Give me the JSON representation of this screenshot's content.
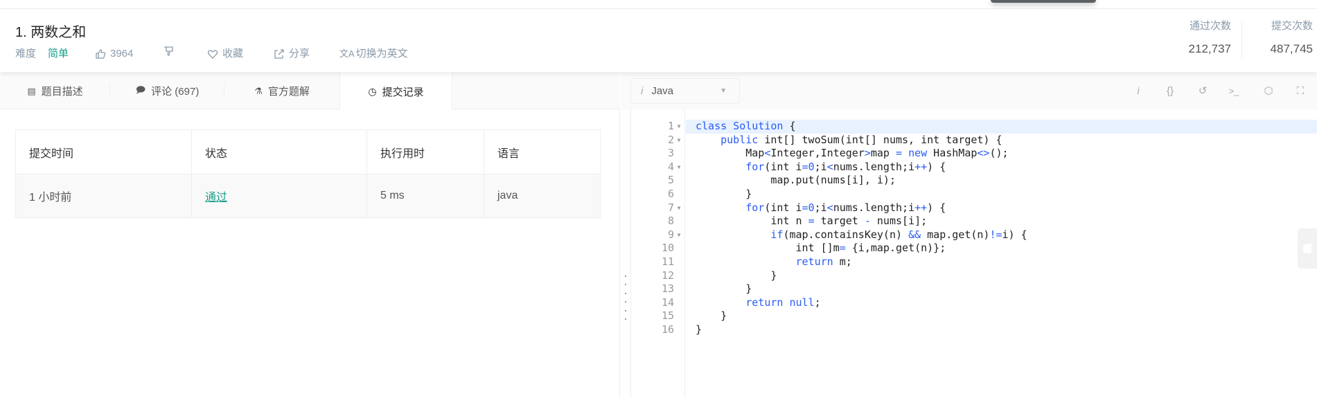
{
  "header": {
    "title": "1. 两数之和",
    "difficulty_label": "难度",
    "difficulty": "简单",
    "likes": "3964",
    "favorite": "收藏",
    "share": "分享",
    "translate": "切换为英文",
    "stats": [
      {
        "label": "通过次数",
        "value": "212,737"
      },
      {
        "label": "提交次数",
        "value": "487,745"
      }
    ]
  },
  "tabs": [
    {
      "label": "题目描述",
      "icon": "document-icon"
    },
    {
      "label": "评论 (697)",
      "icon": "comment-icon"
    },
    {
      "label": "官方题解",
      "icon": "flask-icon"
    },
    {
      "label": "提交记录",
      "icon": "clock-icon",
      "active": true
    }
  ],
  "submissions": {
    "headers": [
      "提交时间",
      "状态",
      "执行用时",
      "语言"
    ],
    "rows": [
      {
        "time": "1 小时前",
        "status": "通过",
        "runtime": "5 ms",
        "language": "java"
      }
    ]
  },
  "editor": {
    "language": "Java",
    "toolbar": [
      "info-icon",
      "format-braces-icon",
      "reset-icon",
      "console-icon",
      "settings-icon",
      "fullscreen-icon"
    ],
    "lines": [
      [
        [
          "class Solution",
          "k"
        ],
        [
          " {",
          ""
        ]
      ],
      [
        [
          "    ",
          ""
        ],
        [
          "public",
          "k"
        ],
        [
          " int[] twoSum(int[] nums, int target) {",
          ""
        ]
      ],
      [
        [
          "        Map",
          ""
        ],
        [
          "<",
          "k"
        ],
        [
          "Integer,Integer",
          ""
        ],
        [
          ">",
          "k"
        ],
        [
          "map ",
          ""
        ],
        [
          "=",
          "k"
        ],
        [
          " ",
          ""
        ],
        [
          "new",
          "k"
        ],
        [
          " HashMap",
          ""
        ],
        [
          "<>",
          "k"
        ],
        [
          "();",
          ""
        ]
      ],
      [
        [
          "        ",
          ""
        ],
        [
          "for",
          "k"
        ],
        [
          "(int i",
          ""
        ],
        [
          "=0",
          "k"
        ],
        [
          ";i",
          ""
        ],
        [
          "<",
          "k"
        ],
        [
          "nums.length;i",
          ""
        ],
        [
          "++",
          "k"
        ],
        [
          ") {",
          ""
        ]
      ],
      [
        [
          "            map.put(nums[i], i);",
          ""
        ]
      ],
      [
        [
          "        }",
          ""
        ]
      ],
      [
        [
          "        ",
          ""
        ],
        [
          "for",
          "k"
        ],
        [
          "(int i",
          ""
        ],
        [
          "=0",
          "k"
        ],
        [
          ";i",
          ""
        ],
        [
          "<",
          "k"
        ],
        [
          "nums.length;i",
          ""
        ],
        [
          "++",
          "k"
        ],
        [
          ") {",
          ""
        ]
      ],
      [
        [
          "            int n ",
          ""
        ],
        [
          "=",
          "k"
        ],
        [
          " target ",
          ""
        ],
        [
          "-",
          "k"
        ],
        [
          " nums[i];",
          ""
        ]
      ],
      [
        [
          "            ",
          ""
        ],
        [
          "if",
          "k"
        ],
        [
          "(map.containsKey(n) ",
          ""
        ],
        [
          "&&",
          "k"
        ],
        [
          " map.get(n)",
          ""
        ],
        [
          "!=",
          "k"
        ],
        [
          "i) {",
          ""
        ]
      ],
      [
        [
          "                int []m",
          ""
        ],
        [
          "=",
          "k"
        ],
        [
          " {i,map.get(n)};",
          ""
        ]
      ],
      [
        [
          "                ",
          ""
        ],
        [
          "return",
          "k"
        ],
        [
          " m;",
          ""
        ]
      ],
      [
        [
          "            }",
          ""
        ]
      ],
      [
        [
          "        }",
          ""
        ]
      ],
      [
        [
          "        ",
          ""
        ],
        [
          "return null",
          "k"
        ],
        [
          ";",
          ""
        ]
      ],
      [
        [
          "    }",
          ""
        ]
      ],
      [
        [
          "}",
          ""
        ]
      ]
    ],
    "foldable": [
      1,
      2,
      4,
      7,
      9
    ],
    "highlighted_line": 1
  },
  "colors": {
    "accent": "#1a9f8c",
    "keyword": "#2a5cf2",
    "line_highlight": "#e8f2ff"
  }
}
